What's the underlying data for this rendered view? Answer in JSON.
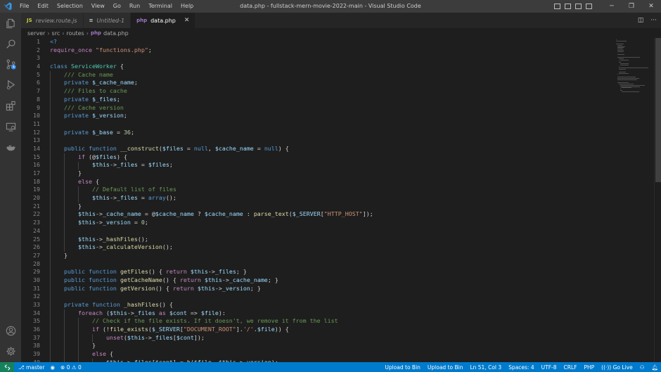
{
  "window": {
    "title": "data.php - fullstack-mern-movie-2022-main - Visual Studio Code"
  },
  "menu": [
    "File",
    "Edit",
    "Selection",
    "View",
    "Go",
    "Run",
    "Terminal",
    "Help"
  ],
  "tabs": [
    {
      "icon": "JS",
      "label": "review.route.js",
      "active": false
    },
    {
      "icon": "≡",
      "label": "Untitled-1",
      "active": false
    },
    {
      "icon": "php",
      "label": "data.php",
      "active": true,
      "close": "✕"
    }
  ],
  "breadcrumb": [
    "server",
    "src",
    "routes",
    "data.php"
  ],
  "code": {
    "lines": [
      "<?",
      "require_once \"functions.php\";",
      "",
      "class ServiceWorker {",
      "    /// Cache name",
      "    private $_cache_name;",
      "    /// Files to cache",
      "    private $_files;",
      "    /// Cache version",
      "    private $_version;",
      "",
      "    private $_base = 36;",
      "",
      "    public function __construct($files = null, $cache_name = null) {",
      "        if (@$files) {",
      "            $this->_files = $files;",
      "        }",
      "        else {",
      "            // Default list of files",
      "            $this->_files = array();",
      "        }",
      "        $this->_cache_name = @$cache_name ? $cache_name : parse_text($_SERVER[\"HTTP_HOST\"]);",
      "        $this->_version = 0;",
      "",
      "        $this->_hashFiles();",
      "        $this->_calculateVersion();",
      "    }",
      "",
      "    public function getFiles() { return $this->_files; }",
      "    public function getCacheName() { return $this->_cache_name; }",
      "    public function getVersion() { return $this->_version; }",
      "",
      "    private function _hashFiles() {",
      "        foreach ($this->_files as $cont => $file):",
      "            // Check if the file exists. If it doesn't, we remove it from the list",
      "            if (!file_exists($_SERVER[\"DOCUMENT_ROOT\"].'/'.$file)) {",
      "                unset($this->_files[$cont]);",
      "            }",
      "            else {",
      "                $this->_files[$cont] = h($file, $this->_version);"
    ]
  },
  "statusbar": {
    "branch": "master",
    "errors": "0",
    "warnings": "0",
    "right": [
      "Upload to Bin",
      "Upload to Bin",
      "Ln 51, Col 3",
      "Spaces: 4",
      "UTF-8",
      "CRLF",
      "PHP",
      "Go Live"
    ]
  }
}
